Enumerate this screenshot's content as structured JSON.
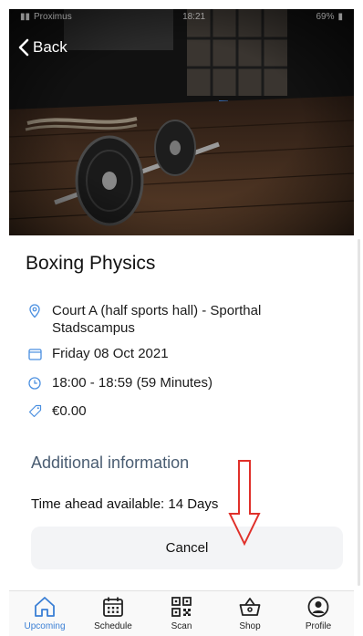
{
  "status_bar": {
    "carrier": "Proximus",
    "time": "18:21",
    "battery": "69%"
  },
  "nav": {
    "back_label": "Back"
  },
  "event": {
    "title": "Boxing Physics",
    "location": "Court A (half sports hall) - Sporthal Stadscampus",
    "date": "Friday 08 Oct 2021",
    "time": "18:00 - 18:59 (59 Minutes)",
    "price": "€0.00"
  },
  "additional": {
    "heading": "Additional information",
    "time_ahead": "Time ahead available: 14 Days"
  },
  "actions": {
    "cancel_label": "Cancel"
  },
  "tabs": [
    {
      "label": "Upcoming",
      "icon": "home-icon",
      "active": true
    },
    {
      "label": "Schedule",
      "icon": "calendar-icon",
      "active": false
    },
    {
      "label": "Scan",
      "icon": "qr-code-icon",
      "active": false
    },
    {
      "label": "Shop",
      "icon": "basket-icon",
      "active": false
    },
    {
      "label": "Profile",
      "icon": "user-circle-icon",
      "active": false
    }
  ],
  "colors": {
    "accent": "#3a7fd5",
    "detail_icon": "#4a8fe0",
    "section_heading": "#4a5d72",
    "annotation_arrow": "#e0302a"
  }
}
